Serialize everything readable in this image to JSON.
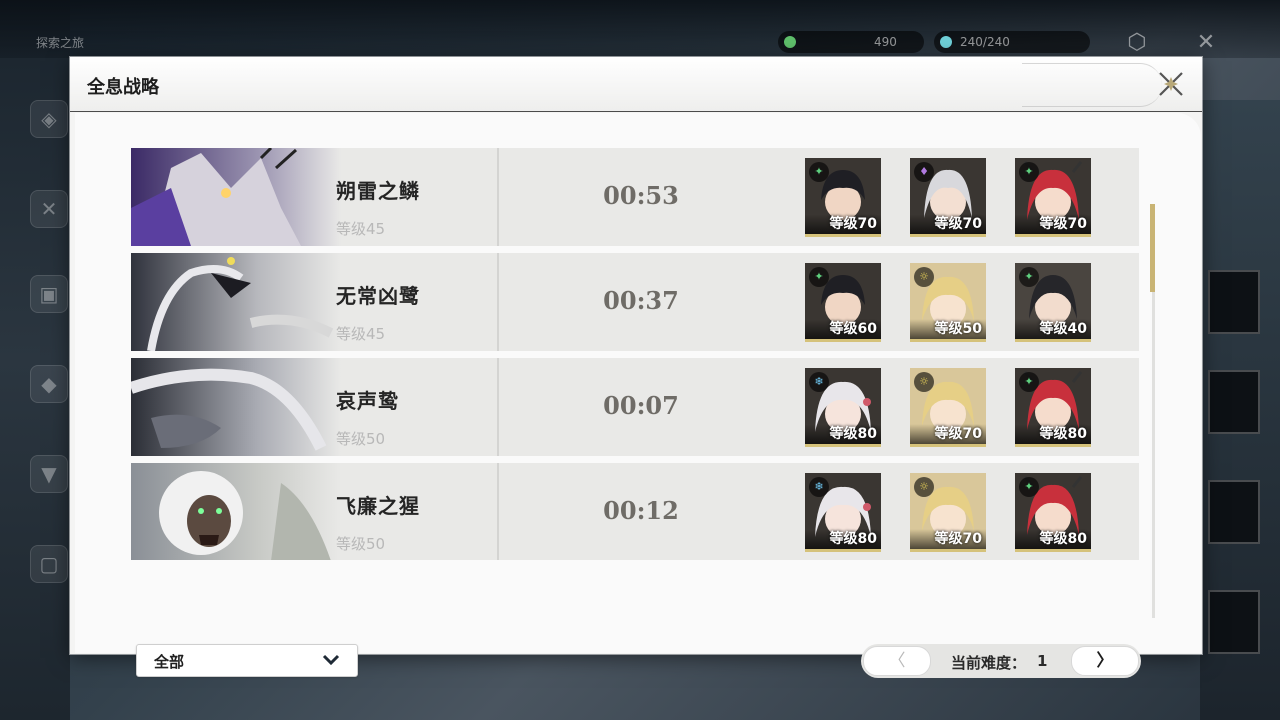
{
  "background": {
    "top_title": "探索之旅",
    "currency": [
      {
        "value": "490",
        "color": "#5fbf6b"
      },
      {
        "value": "240/240",
        "color": "#6fd0d8"
      }
    ]
  },
  "modal": {
    "title": "全息战略"
  },
  "bosses": [
    {
      "name": "朔雷之鳞",
      "level": "等级45",
      "time": "00:53",
      "team": [
        {
          "level": "等级70",
          "element": "wind",
          "element_color": "#5fd07f",
          "hair": "#1f1f24",
          "skin": "#f0d6c4"
        },
        {
          "level": "等级70",
          "element": "havoc",
          "element_color": "#b07ae0",
          "hair": "#d8d8dc",
          "skin": "#f3dfd2"
        },
        {
          "level": "等级70",
          "element": "wind",
          "element_color": "#5fd07f",
          "hair": "#c8303c",
          "skin": "#f5dccc"
        }
      ]
    },
    {
      "name": "无常凶鹭",
      "level": "等级45",
      "time": "00:37",
      "team": [
        {
          "level": "等级60",
          "element": "wind",
          "element_color": "#5fd07f",
          "hair": "#1f1f24",
          "skin": "#f0d6c4"
        },
        {
          "level": "等级50",
          "element": "spectro",
          "element_color": "#e8d35a",
          "hair": "#e6cf86",
          "skin": "#f7e3cf"
        },
        {
          "level": "等级40",
          "element": "wind",
          "element_color": "#5fd07f",
          "hair": "#26262a",
          "skin": "#f2dccd"
        }
      ]
    },
    {
      "name": "哀声鸷",
      "level": "等级50",
      "time": "00:07",
      "team": [
        {
          "level": "等级80",
          "element": "glacio",
          "element_color": "#6fc6f0",
          "hair": "#e8e6ea",
          "skin": "#f6e4dc"
        },
        {
          "level": "等级70",
          "element": "spectro",
          "element_color": "#e8d35a",
          "hair": "#e6cf86",
          "skin": "#f7e3cf"
        },
        {
          "level": "等级80",
          "element": "wind",
          "element_color": "#5fd07f",
          "hair": "#c8303c",
          "skin": "#f5dccc"
        }
      ]
    },
    {
      "name": "飞廉之猩",
      "level": "等级50",
      "time": "00:12",
      "team": [
        {
          "level": "等级80",
          "element": "glacio",
          "element_color": "#6fc6f0",
          "hair": "#e8e6ea",
          "skin": "#f6e4dc"
        },
        {
          "level": "等级70",
          "element": "spectro",
          "element_color": "#e8d35a",
          "hair": "#e6cf86",
          "skin": "#f7e3cf"
        },
        {
          "level": "等级80",
          "element": "wind",
          "element_color": "#5fd07f",
          "hair": "#c8303c",
          "skin": "#f5dccc"
        }
      ]
    }
  ],
  "footer": {
    "filter_value": "全部",
    "difficulty_label": "当前难度：",
    "difficulty_value": "1",
    "prev_symbol": "〈",
    "next_symbol": "〉"
  },
  "colors": {
    "accent_gold": "#c9b474",
    "time_text": "#6f6c67",
    "row_bg": "#e9e9e7"
  }
}
